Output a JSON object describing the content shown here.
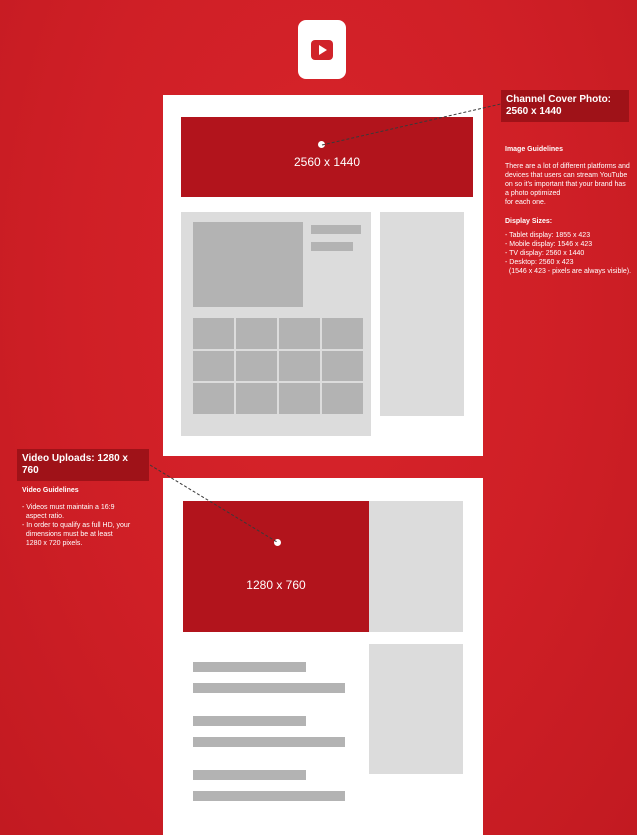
{
  "colors": {
    "background": "#cf1f26",
    "dark_red": "#b2141c",
    "callout": "#9f1218",
    "light_gray": "#dcdcdc",
    "mid_gray": "#b3b3b3"
  },
  "logo": {
    "icon": "youtube-play-icon"
  },
  "cover": {
    "block_label": "2560 x 1440",
    "callout_line1": "Channel Cover Photo:",
    "callout_line2": "2560 x 1440",
    "guidelines_title": "Image Guidelines",
    "guidelines_lines": [
      "There are a lot of different platforms and",
      "devices that users can stream YouTube",
      "on so it's important that your brand has",
      "a photo optimized",
      "for each one."
    ],
    "sizes_title": "Display Sizes:",
    "sizes_lines": [
      "- Tablet display: 1855 x 423",
      "- Mobile display: 1546 x 423",
      "- TV display: 2560 x 1440",
      "- Desktop: 2560 x 423",
      "  (1546 x 423 - pixels are always visible)."
    ]
  },
  "video": {
    "block_label": "1280 x 760",
    "callout": "Video Uploads: 1280 x 760",
    "guidelines_title": "Video Guidelines",
    "guidelines_lines": [
      "- Videos must maintain a 16:9",
      "  aspect ratio.",
      "- In order to qualify as full HD, your",
      "  dimensions must be at least",
      "  1280 x 720 pixels."
    ]
  }
}
